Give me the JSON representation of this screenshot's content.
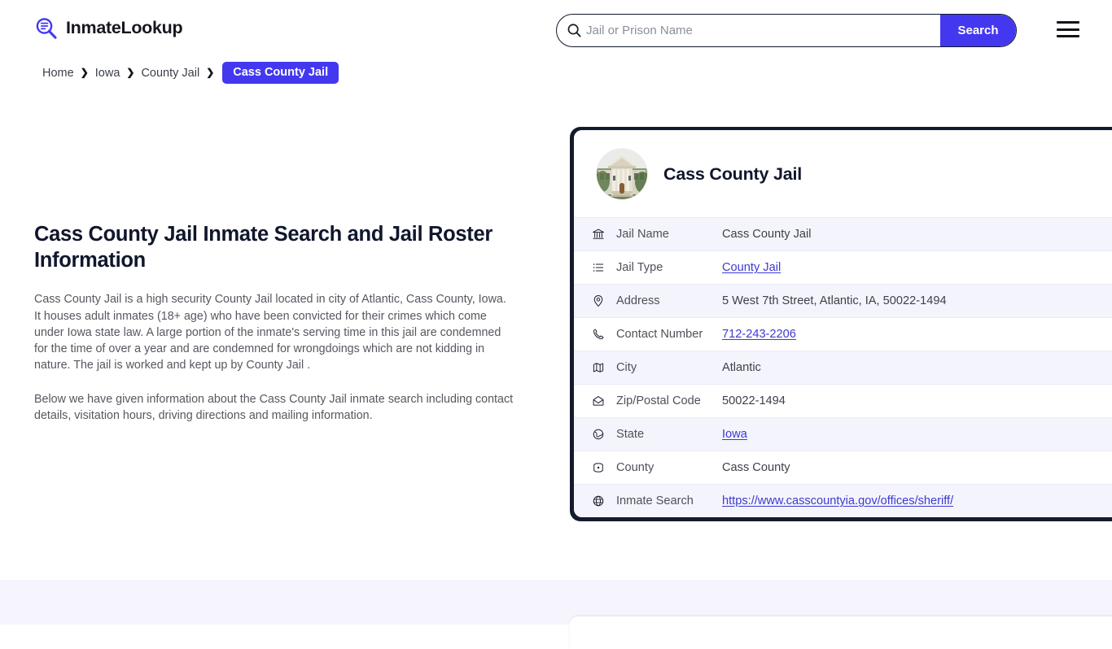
{
  "brand": {
    "name": "InmateLookup",
    "logo_icon": "magnifier-list-icon",
    "accent_color": "#4338f0"
  },
  "search": {
    "placeholder": "Jail or Prison Name",
    "value": "",
    "button_label": "Search",
    "icon": "search-icon"
  },
  "menu": {
    "icon": "hamburger-menu-icon"
  },
  "breadcrumb": {
    "items": [
      {
        "label": "Home"
      },
      {
        "label": "Iowa"
      },
      {
        "label": "County Jail"
      }
    ],
    "separator": "❯",
    "current": "Cass County Jail"
  },
  "article": {
    "title": "Cass County Jail Inmate Search and Jail Roster Information",
    "paragraph1": "Cass County Jail is a high security County Jail located in city of Atlantic, Cass County, Iowa. It houses adult inmates (18+ age) who have been convicted for their crimes which come under Iowa state law. A large portion of the inmate's serving time in this jail are condemned for the time of over a year and are condemned for wrongdoings which are not kidding in nature. The jail is worked and kept up by County Jail .",
    "paragraph2": "Below we have given information about the Cass County Jail inmate search including contact details, visitation hours, driving directions and mailing information."
  },
  "card": {
    "title": "Cass County Jail",
    "avatar_icon": "courthouse-photo",
    "rows": [
      {
        "icon": "bank-icon",
        "label": "Jail Name",
        "value": "Cass County Jail",
        "link": false
      },
      {
        "icon": "list-icon",
        "label": "Jail Type",
        "value": "County Jail",
        "link": true
      },
      {
        "icon": "map-pin-icon",
        "label": "Address",
        "value": "5 West 7th Street, Atlantic, IA, 50022-1494",
        "link": false
      },
      {
        "icon": "phone-icon",
        "label": "Contact Number",
        "value": "712-243-2206",
        "link": true
      },
      {
        "icon": "map-icon",
        "label": "City",
        "value": "Atlantic",
        "link": false
      },
      {
        "icon": "envelope-icon",
        "label": "Zip/Postal Code",
        "value": "50022-1494",
        "link": false
      },
      {
        "icon": "globe-state-icon",
        "label": "State",
        "value": "Iowa",
        "link": true
      },
      {
        "icon": "county-pin-icon",
        "label": "County",
        "value": "Cass County",
        "link": false
      },
      {
        "icon": "globe-icon",
        "label": "Inmate Search",
        "value": "https://www.casscountyia.gov/offices/sheriff/",
        "link": true
      }
    ]
  }
}
